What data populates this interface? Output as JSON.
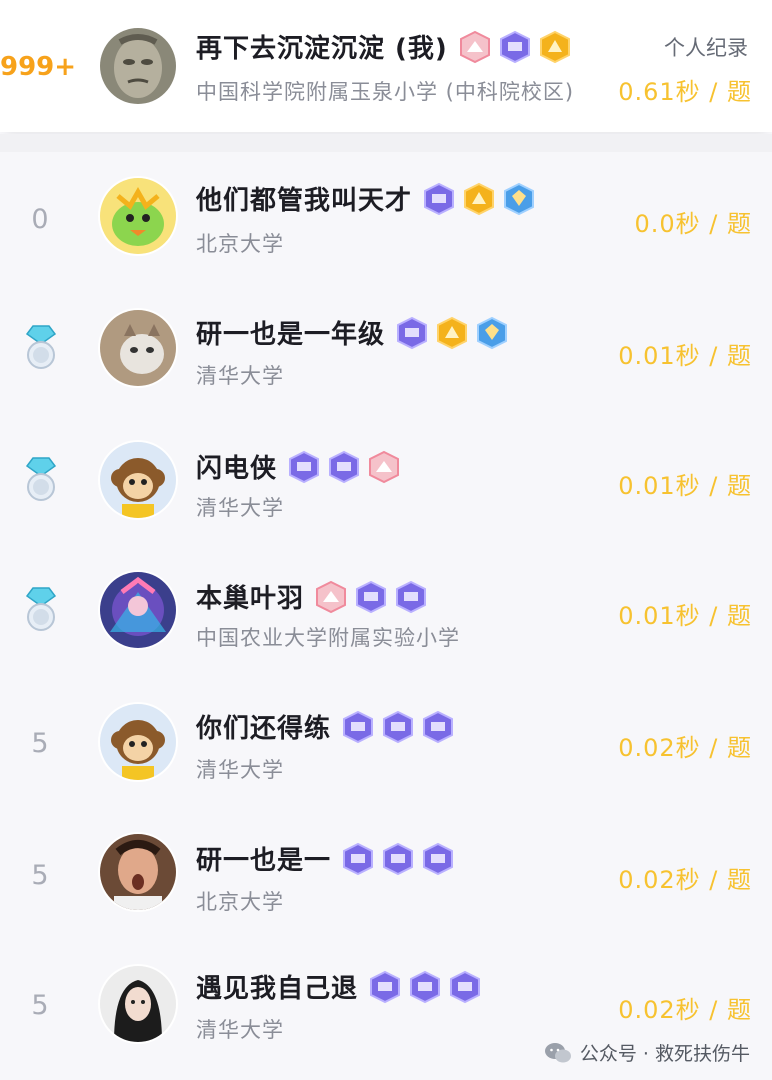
{
  "me": {
    "rank": "999+",
    "name": "再下去沉淀沉淀 (我)",
    "school": "中国科学院附属玉泉小学 (中科院校区)",
    "record_label": "个人纪录",
    "time": "0.61秒 / 题",
    "badges": [
      "pink",
      "purple",
      "gold"
    ]
  },
  "list": [
    {
      "rank": "0",
      "medal": "",
      "name": "他们都管我叫天才",
      "school": "北京大学",
      "time": "0.0秒 / 题",
      "badges": [
        "purple",
        "gold",
        "blue"
      ],
      "avatar": "green-bird"
    },
    {
      "rank": "",
      "medal": "diamond",
      "name": "研一也是一年级",
      "school": "清华大学",
      "time": "0.01秒 / 题",
      "badges": [
        "purple",
        "gold",
        "blue"
      ],
      "avatar": "cat"
    },
    {
      "rank": "",
      "medal": "diamond",
      "name": "闪电侠",
      "school": "清华大学",
      "time": "0.01秒 / 题",
      "badges": [
        "purple",
        "purple",
        "pink"
      ],
      "avatar": "monkey"
    },
    {
      "rank": "",
      "medal": "diamond",
      "name": "本巢叶羽",
      "school": "中国农业大学附属实验小学",
      "time": "0.01秒 / 题",
      "badges": [
        "pink",
        "purple",
        "purple"
      ],
      "avatar": "anime"
    },
    {
      "rank": "5",
      "medal": "",
      "name": "你们还得练",
      "school": "清华大学",
      "time": "0.02秒 / 题",
      "badges": [
        "purple",
        "purple",
        "purple"
      ],
      "avatar": "monkey"
    },
    {
      "rank": "5",
      "medal": "",
      "name": "研一也是一",
      "school": "北京大学",
      "time": "0.02秒 / 题",
      "badges": [
        "purple",
        "purple",
        "purple"
      ],
      "avatar": "person"
    },
    {
      "rank": "5",
      "medal": "",
      "name": "遇见我自己退",
      "school": "清华大学",
      "time": "0.02秒 / 题",
      "badges": [
        "purple",
        "purple",
        "purple"
      ],
      "avatar": "girl"
    }
  ],
  "watermark": "公众号 · 救死扶伤牛",
  "colors": {
    "accent_orange": "#f7a21b",
    "time_yellow": "#f7c230",
    "badge_purple": "#7a6ae6",
    "badge_pink": "#f29aa8",
    "badge_gold": "#f4b21c",
    "badge_blue": "#4a9ee8"
  }
}
